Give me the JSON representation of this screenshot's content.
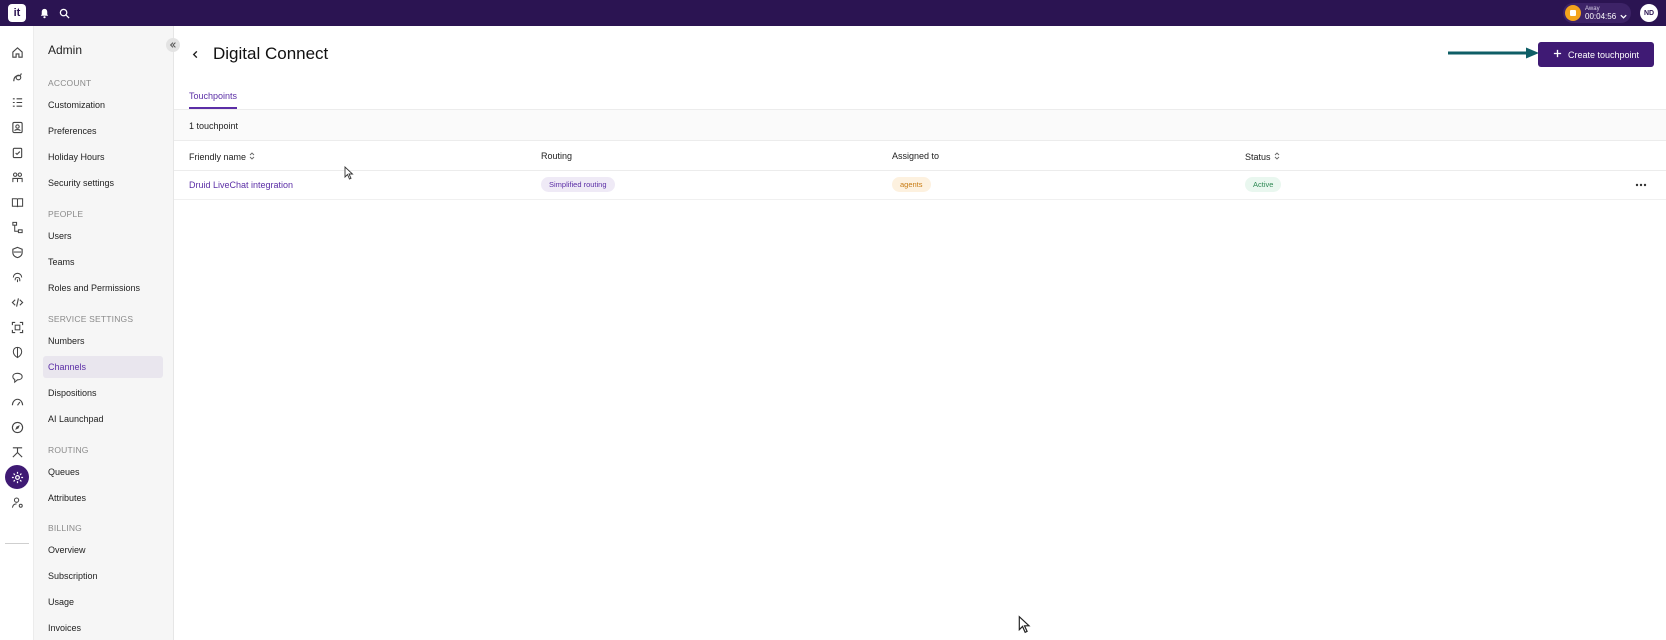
{
  "topbar": {
    "logo_text": "it",
    "status": {
      "label": "Away",
      "time": "00:04:56"
    },
    "avatar_initials": "ND"
  },
  "rail": {
    "icons": [
      "home-icon",
      "leads-icon",
      "tasks-icon",
      "contacts-icon",
      "clipboard-icon",
      "people-icon",
      "book-icon",
      "flow-icon",
      "shield-icon",
      "fingerprint-icon",
      "code-icon",
      "scan-icon",
      "ai-icon",
      "chat-icon",
      "gauge-icon",
      "compass-icon",
      "routing-icon",
      "settings-icon",
      "user-settings-icon"
    ],
    "active": "settings-icon"
  },
  "sidebar": {
    "title": "Admin",
    "sections": [
      {
        "label": "ACCOUNT",
        "items": [
          "Customization",
          "Preferences",
          "Holiday Hours",
          "Security settings"
        ]
      },
      {
        "label": "PEOPLE",
        "items": [
          "Users",
          "Teams",
          "Roles and Permissions"
        ]
      },
      {
        "label": "SERVICE SETTINGS",
        "items": [
          "Numbers",
          "Channels",
          "Dispositions",
          "AI Launchpad"
        ]
      },
      {
        "label": "ROUTING",
        "items": [
          "Queues",
          "Attributes"
        ]
      },
      {
        "label": "BILLING",
        "items": [
          "Overview",
          "Subscription",
          "Usage",
          "Invoices"
        ]
      }
    ],
    "active_item": "Channels"
  },
  "page": {
    "title": "Digital Connect",
    "create_button": "Create touchpoint",
    "tab": "Touchpoints",
    "count": "1 touchpoint"
  },
  "table": {
    "columns": [
      "Friendly name",
      "Routing",
      "Assigned to",
      "Status"
    ],
    "rows": [
      {
        "name": "Druid LiveChat integration",
        "routing": "Simplified routing",
        "assigned": "agents",
        "status": "Active"
      }
    ]
  },
  "colors": {
    "topbar": "#2b1452",
    "primary": "#3f1a74",
    "accent_text": "#5b2ea6",
    "arrow": "#0e5e66"
  }
}
